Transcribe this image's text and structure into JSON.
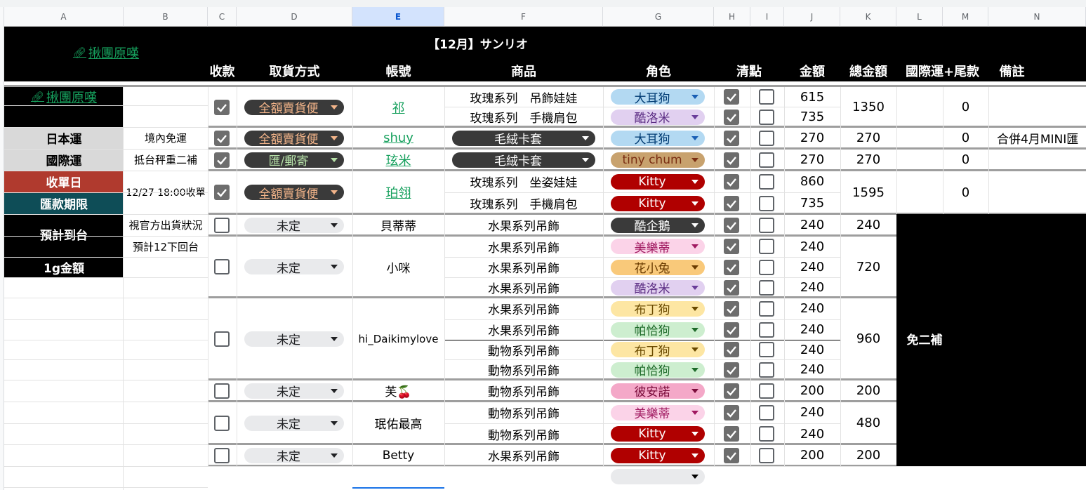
{
  "columns": [
    "A",
    "B",
    "C",
    "D",
    "E",
    "F",
    "G",
    "H",
    "I",
    "J",
    "K",
    "L",
    "M",
    "N"
  ],
  "banner": {
    "title": "【12月】サンリオ",
    "link": "揪團原嘆"
  },
  "headers": {
    "paid": "收款",
    "pickup": "取貨方式",
    "account": "帳號",
    "product": "商品",
    "character": "角色",
    "check": "清點",
    "amount": "金額",
    "total": "總金額",
    "shipping": "國際運+尾款",
    "note": "備註"
  },
  "sidebar": {
    "link": "揪團原嘆",
    "japan_label": "日本運",
    "japan_value": "境內免運",
    "intl_label": "國際運",
    "intl_value": "抵台秤重二補",
    "close_label": "收單日",
    "close_value": "12/27 18:00收單",
    "pay_label": "匯款期限",
    "eta_label": "預計到台",
    "eta_value1": "視官方出貨狀況",
    "eta_value2": "預計12下回台",
    "gram_label": "1g金額"
  },
  "orders": [
    {
      "account": "祁",
      "pickup": "全額賣貨便",
      "total": "1350",
      "shipping": "0",
      "note": "",
      "items": [
        {
          "product": "玫瑰系列　吊飾娃娃",
          "character": "大耳狗",
          "amount": "615"
        },
        {
          "product": "玫瑰系列　手機肩包",
          "character": "酷洛米",
          "amount": "735"
        }
      ]
    },
    {
      "account": "shuy",
      "pickup": "全額賣貨便",
      "total": "270",
      "shipping": "0",
      "note": "合併4月MINI匯",
      "items": [
        {
          "product": "毛絨卡套",
          "character": "大耳狗",
          "amount": "270"
        }
      ]
    },
    {
      "account": "玹米",
      "pickup": "匯/郵寄",
      "total": "270",
      "shipping": "0",
      "note": "",
      "items": [
        {
          "product": "毛絨卡套",
          "character": "tiny chum",
          "amount": "270"
        }
      ]
    },
    {
      "account": "珀翎",
      "pickup": "全額賣貨便",
      "total": "1595",
      "shipping": "0",
      "note": "",
      "items": [
        {
          "product": "玫瑰系列　坐姿娃娃",
          "character": "Kitty",
          "amount": "860"
        },
        {
          "product": "玫瑰系列　手機肩包",
          "character": "Kitty",
          "amount": "735"
        }
      ]
    },
    {
      "account": "貝蒂蒂",
      "pickup": "未定",
      "total": "240",
      "items": [
        {
          "product": "水果系列吊飾",
          "character": "酷企鵝",
          "amount": "240"
        }
      ]
    },
    {
      "account": "小咪",
      "pickup": "未定",
      "total": "720",
      "items": [
        {
          "product": "水果系列吊飾",
          "character": "美樂蒂",
          "amount": "240"
        },
        {
          "product": "水果系列吊飾",
          "character": "花小兔",
          "amount": "240"
        },
        {
          "product": "水果系列吊飾",
          "character": "酷洛米",
          "amount": "240"
        }
      ]
    },
    {
      "account": "hi_Daikimylove",
      "pickup": "未定",
      "total": "960",
      "items": [
        {
          "product": "水果系列吊飾",
          "character": "布丁狗",
          "amount": "240"
        },
        {
          "product": "水果系列吊飾",
          "character": "帕恰狗",
          "amount": "240"
        },
        {
          "product": "動物系列吊飾",
          "character": "布丁狗",
          "amount": "240"
        },
        {
          "product": "動物系列吊飾",
          "character": "帕恰狗",
          "amount": "240"
        }
      ]
    },
    {
      "account": "芙🍒",
      "pickup": "未定",
      "total": "200",
      "items": [
        {
          "product": "動物系列吊飾",
          "character": "彼安諾",
          "amount": "200"
        }
      ]
    },
    {
      "account": "珉佑最高",
      "pickup": "未定",
      "total": "480",
      "items": [
        {
          "product": "動物系列吊飾",
          "character": "美樂蒂",
          "amount": "240"
        },
        {
          "product": "動物系列吊飾",
          "character": "Kitty",
          "amount": "240"
        }
      ]
    },
    {
      "account": "Betty",
      "pickup": "未定",
      "total": "200",
      "items": [
        {
          "product": "水果系列吊飾",
          "character": "Kitty",
          "amount": "200"
        }
      ]
    }
  ],
  "no_supplement": "免二補",
  "colors": {
    "link": "#16a05d",
    "black_header": "#000000",
    "close_red": "#b03a2e",
    "pay_teal": "#0e4d57"
  }
}
